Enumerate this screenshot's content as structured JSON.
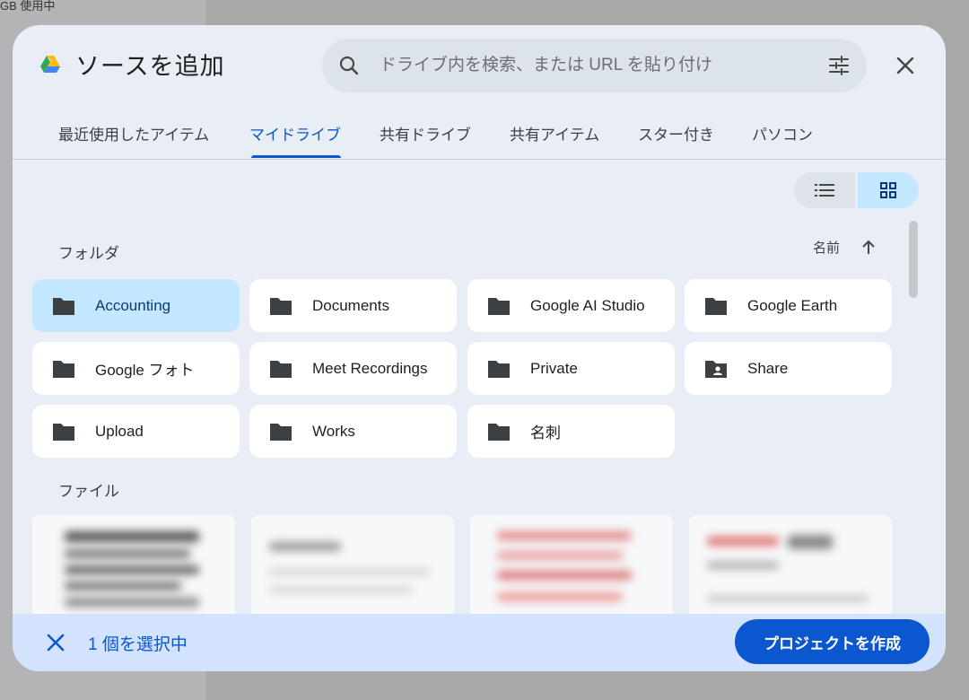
{
  "background": {
    "usage_text": "GB 使用中"
  },
  "dialog": {
    "title": "ソースを追加",
    "search": {
      "placeholder": "ドライブ内を検索、または URL を貼り付け"
    },
    "tabs": [
      {
        "label": "最近使用したアイテム",
        "active": false
      },
      {
        "label": "マイドライブ",
        "active": true
      },
      {
        "label": "共有ドライブ",
        "active": false
      },
      {
        "label": "共有アイテム",
        "active": false
      },
      {
        "label": "スター付き",
        "active": false
      },
      {
        "label": "パソコン",
        "active": false
      }
    ],
    "view_mode": "grid",
    "sections": {
      "folders_label": "フォルダ",
      "files_label": "ファイル"
    },
    "sort": {
      "label": "名前",
      "direction": "ascending"
    },
    "folders": [
      {
        "name": "Accounting",
        "icon": "folder-icon",
        "selected": true
      },
      {
        "name": "Documents",
        "icon": "folder-icon",
        "selected": false
      },
      {
        "name": "Google AI Studio",
        "icon": "folder-icon",
        "selected": false
      },
      {
        "name": "Google Earth",
        "icon": "folder-icon",
        "selected": false
      },
      {
        "name": "Google フォト",
        "icon": "folder-icon",
        "selected": false
      },
      {
        "name": "Meet Recordings",
        "icon": "folder-icon",
        "selected": false
      },
      {
        "name": "Private",
        "icon": "folder-icon",
        "selected": false
      },
      {
        "name": "Share",
        "icon": "shared-folder-icon",
        "selected": false
      },
      {
        "name": "Upload",
        "icon": "folder-icon",
        "selected": false
      },
      {
        "name": "Works",
        "icon": "folder-icon",
        "selected": false
      },
      {
        "name": "名刺",
        "icon": "folder-icon",
        "selected": false
      }
    ],
    "footer": {
      "selected_text": "1 個を選択中",
      "create_button": "プロジェクトを作成"
    },
    "colors": {
      "accent": "#0b57d0",
      "selected_bg": "#c2e7ff",
      "dialog_bg": "#e9eef6"
    }
  }
}
